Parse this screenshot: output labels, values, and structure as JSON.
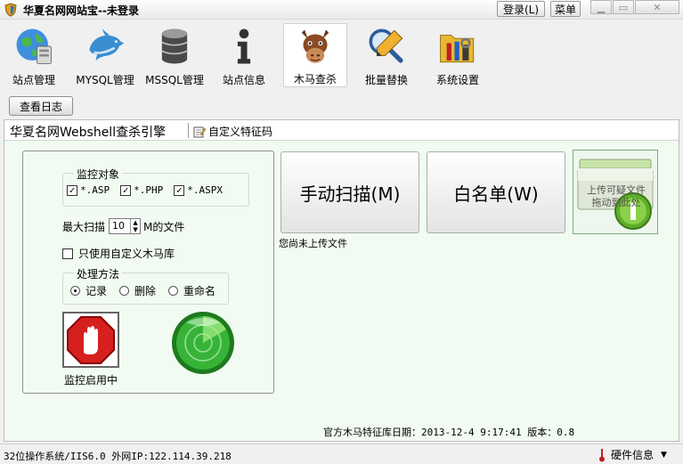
{
  "window": {
    "title": "华夏名网网站宝--未登录",
    "login_label": "登录(L)",
    "menu_label": "菜单"
  },
  "toolbar": {
    "items": [
      {
        "label": "站点管理",
        "icon": "globe-server-icon"
      },
      {
        "label": "MYSQL管理",
        "icon": "dolphin-icon"
      },
      {
        "label": "MSSQL管理",
        "icon": "database-icon"
      },
      {
        "label": "站点信息",
        "icon": "info-icon"
      },
      {
        "label": "木马查杀",
        "icon": "trojan-horse-icon"
      },
      {
        "label": "批量替换",
        "icon": "magnifier-pencil-icon"
      },
      {
        "label": "系统设置",
        "icon": "tools-folder-icon"
      }
    ],
    "active_index": 4
  },
  "log_button": "查看日志",
  "engine": {
    "title": "华夏名网Webshell查杀引擎",
    "custom_signature": "自定义特征码"
  },
  "monitor": {
    "targets_title": "监控对象",
    "targets": [
      {
        "label": "*.ASP",
        "checked": true
      },
      {
        "label": "*.PHP",
        "checked": true
      },
      {
        "label": "*.ASPX",
        "checked": true
      }
    ],
    "max_scan_label": "最大扫描",
    "max_scan_value": "10",
    "max_scan_unit": "M的文件",
    "custom_lib_label": "只使用自定义木马库",
    "custom_lib_checked": false,
    "handling_title": "处理方法",
    "handling_options": [
      {
        "label": "记录",
        "selected": true
      },
      {
        "label": "删除",
        "selected": false
      },
      {
        "label": "重命名",
        "selected": false
      }
    ],
    "status_label": "监控启用中"
  },
  "actions": {
    "manual_scan": "手动扫描(M)",
    "whitelist": "白名单(W)",
    "upload_line1": "上传可疑文件",
    "upload_line2": "拖动到此处",
    "upload_status": "您尚未上传文件"
  },
  "footer": {
    "signature_info": "官方木马特征库日期：2013-12-4 9:17:41 版本：0.8"
  },
  "statusbar": {
    "system_info": "32位操作系统/IIS6.0 外网IP:122.114.39.218",
    "hardware_info": "硬件信息"
  },
  "colors": {
    "panel_bg": "#f2fbf2",
    "stop_red": "#d62020",
    "radar_green": "#2faa2f"
  }
}
